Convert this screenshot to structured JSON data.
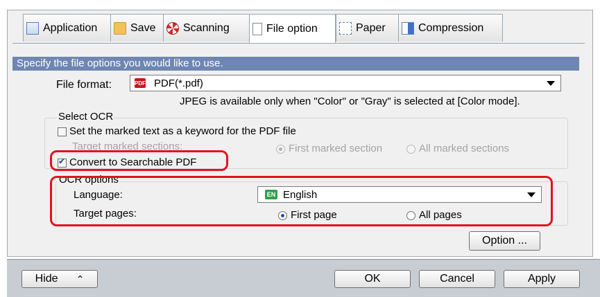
{
  "tabs": [
    {
      "label": "Application",
      "icon": "application-icon"
    },
    {
      "label": "Save",
      "icon": "folder-icon"
    },
    {
      "label": "Scanning",
      "icon": "scanning-icon"
    },
    {
      "label": "File option",
      "icon": "file-option-icon",
      "active": true
    },
    {
      "label": "Paper",
      "icon": "paper-icon"
    },
    {
      "label": "Compression",
      "icon": "compression-icon"
    }
  ],
  "header": {
    "text": "Specify the file options you would like to use."
  },
  "file_format": {
    "label": "File format:",
    "value": "PDF(*.pdf)",
    "badge": "PDF",
    "note": "JPEG is available only when \"Color\" or \"Gray\" is selected at [Color mode]."
  },
  "select_ocr": {
    "title": "Select OCR",
    "keyword_checkbox": {
      "label": "Set the marked text as a keyword for the PDF file",
      "checked": false
    },
    "target_marked_label": "Target marked sections:",
    "first_marked": "First marked section",
    "all_marked": "All marked sections"
  },
  "convert": {
    "label": "Convert to Searchable PDF",
    "checked": true
  },
  "ocr_options": {
    "title": "OCR options",
    "language_label": "Language:",
    "language_value": "English",
    "language_badge": "EN",
    "target_pages_label": "Target pages:",
    "first_page": "First page",
    "all_pages": "All pages",
    "selected": "First page"
  },
  "option_button": "Option ...",
  "bottom": {
    "hide": "Hide",
    "hide_arrow": "⌃",
    "ok": "OK",
    "cancel": "Cancel",
    "apply": "Apply"
  },
  "colors": {
    "header_bg": "#6e86b2",
    "highlight": "#e0141f",
    "bottom_bar": "#c8ccd3"
  }
}
